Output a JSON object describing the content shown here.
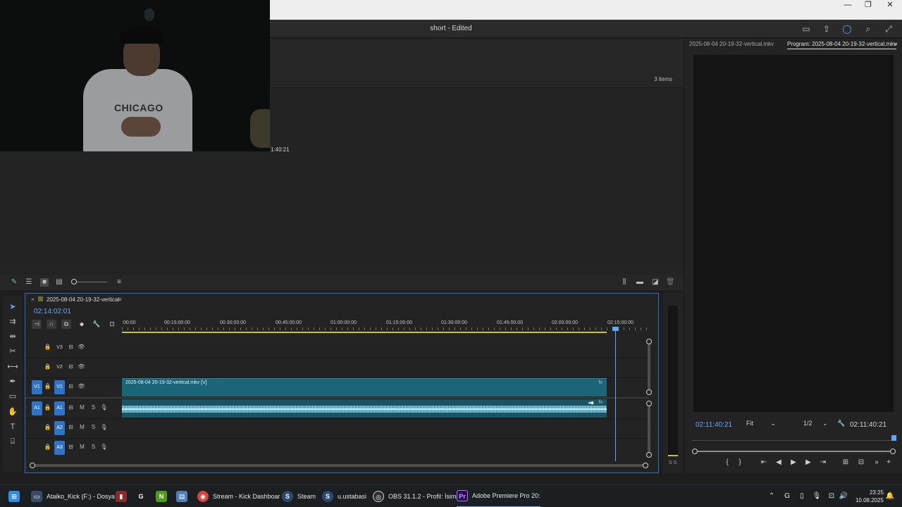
{
  "window": {
    "minimize": "—",
    "maximize": "❐",
    "close": "✕"
  },
  "app": {
    "doc_title": "short - Edited"
  },
  "project": {
    "items_count": "3 items",
    "thumb_duration": "1:40:21"
  },
  "program_monitor": {
    "source_tab": "2025-08-04 20-19-32-vertical.mkv",
    "program_tab": "Program: 2025-08-04 20-19-32-vertical.mkv",
    "playhead_tc": "02:11:40:21",
    "fit": "Fit",
    "resolution": "1/2",
    "duration_tc": "02:11:40:21"
  },
  "timeline": {
    "sequence_name": "2025-08-04 20-19-32-vertical",
    "current_tc": "02:14:02:01",
    "ruler": [
      ":00:00",
      "00:15:00:00",
      "00:30:00:00",
      "00:45:00:00",
      "01:00:00:00",
      "01:15:00:00",
      "01:30:00:00",
      "01:45:00:00",
      "02:00:00:00",
      "02:15:00:00"
    ],
    "tracks": {
      "v3": "V3",
      "v2": "V2",
      "v1": "V1",
      "a1": "A1",
      "a2": "A2",
      "a3": "A3",
      "mute": "M",
      "solo": "S"
    },
    "video_clip_label": "2025-08-04 20-19-32-vertical.mkv [V]"
  },
  "audio_meter": {
    "label": "S S"
  },
  "webcam": {
    "shirt_text": "CHICAGO"
  },
  "taskbar": {
    "items": [
      {
        "label": "Ataiko_Kick (F:) - Dosya"
      },
      {
        "label": "Stream - Kick Dashboar"
      },
      {
        "label": "Steam"
      },
      {
        "label": "u.ustabasi"
      },
      {
        "label": "OBS 31.1.2 - Profil: İsims"
      },
      {
        "label": "Adobe Premiere Pro 20:"
      }
    ],
    "premiere_icon": "Pr",
    "time": "23:25",
    "date": "10.08.2025"
  },
  "colors": {
    "accent_blue": "#5fa8ff",
    "clip_video": "#1a6577",
    "clip_audio": "#1a5463",
    "target_blue": "#2f73c8",
    "work_area": "#c5c43a"
  }
}
